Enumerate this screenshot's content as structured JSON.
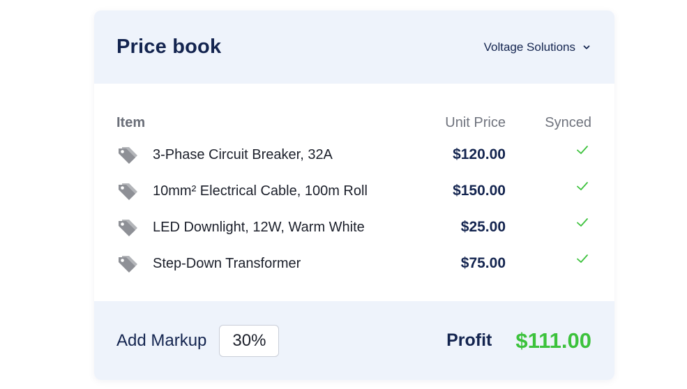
{
  "header": {
    "title": "Price book",
    "company": "Voltage Solutions"
  },
  "table": {
    "columns": {
      "item": "Item",
      "unit_price": "Unit Price",
      "synced": "Synced"
    },
    "rows": [
      {
        "item": "3-Phase Circuit Breaker, 32A",
        "price": "$120.00",
        "synced": true
      },
      {
        "item": "10mm² Electrical Cable, 100m Roll",
        "price": "$150.00",
        "synced": true
      },
      {
        "item": "LED Downlight, 12W, Warm White",
        "price": "$25.00",
        "synced": true
      },
      {
        "item": "Step-Down Transformer",
        "price": "$75.00",
        "synced": true
      }
    ]
  },
  "footer": {
    "markup_label": "Add Markup",
    "markup_value": "30%",
    "profit_label": "Profit",
    "profit_value": "$111.00"
  },
  "colors": {
    "accent_navy": "#13244f",
    "success_green": "#3cc23c",
    "panel_bg": "#eef3fb"
  },
  "icons": {
    "row_icon": "price-tag-icon",
    "synced_icon": "check-icon",
    "dropdown_icon": "chevron-down-icon"
  }
}
